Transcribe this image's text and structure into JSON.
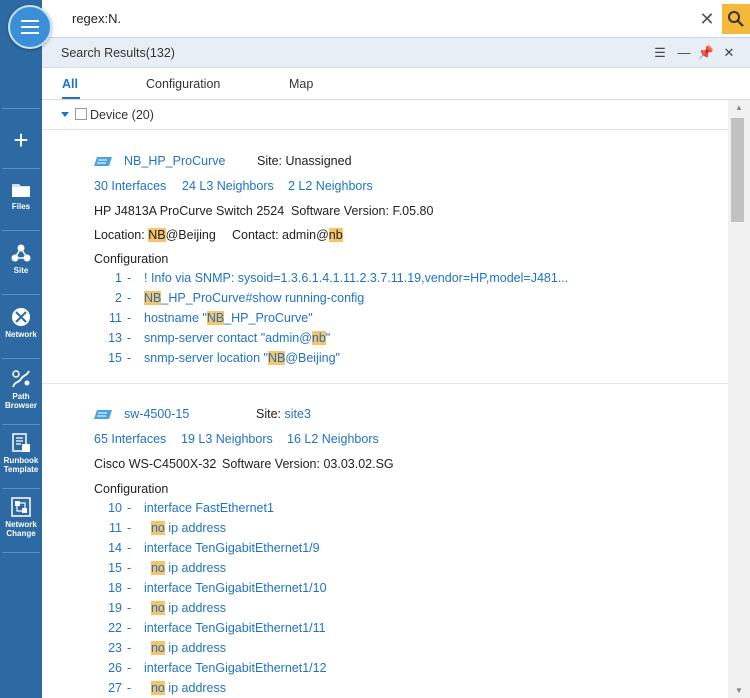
{
  "nav": {
    "items": [
      {
        "label": "Files"
      },
      {
        "label": "Site"
      },
      {
        "label": "Network"
      },
      {
        "label": "Path\nBrowser"
      },
      {
        "label": "Runbook\nTemplate"
      },
      {
        "label": "Network\nChange"
      }
    ]
  },
  "search": {
    "query": "regex:N."
  },
  "panel": {
    "title": "Search Results(132)"
  },
  "tabs": [
    {
      "label": "All",
      "active": true
    },
    {
      "label": "Configuration",
      "active": false
    },
    {
      "label": "Map",
      "active": false
    }
  ],
  "group": {
    "label": "Device (20)"
  },
  "results": [
    {
      "device_name": "NB_HP_ProCurve",
      "site_label": "Site:",
      "site": "Unassigned",
      "interfaces": "30 Interfaces",
      "l3": "24 L3 Neighbors",
      "l2": "2 L2 Neighbors",
      "vendor_model": "HP  J4813A ProCurve Switch 2524",
      "software": "Software Version: F.05.80",
      "location_prefix": "Location: ",
      "location_hl": "NB",
      "location_rest": "@Beijing",
      "contact_prefix": "Contact: admin@",
      "contact_hl": "nb",
      "config_label": "Configuration",
      "config_lines": [
        {
          "num": "1",
          "pre": "! Info via SNMP: sysoid=1.3.6.1.4.1.11.2.3.7.11.19,vendor=HP,model=J481...",
          "hl": "",
          "post": ""
        },
        {
          "num": "2",
          "pre": "",
          "hl": "NB",
          "post": "_HP_ProCurve#show running-config"
        },
        {
          "num": "11",
          "pre": "hostname \"",
          "hl": "NB",
          "post": "_HP_ProCurve\""
        },
        {
          "num": "13",
          "pre": "snmp-server contact \"admin@",
          "hl": "nb",
          "post": "\""
        },
        {
          "num": "15",
          "pre": "snmp-server location \"",
          "hl": "NB",
          "post": "@Beijing\""
        }
      ]
    },
    {
      "device_name": "sw-4500-15",
      "site_label": "Site:",
      "site": "site3",
      "interfaces": "65 Interfaces",
      "l3": "19 L3 Neighbors",
      "l2": "16 L2 Neighbors",
      "vendor_model": "Cisco  WS-C4500X-32",
      "software": "Software Version: 03.03.02.SG",
      "config_label": "Configuration",
      "config_lines": [
        {
          "num": "10",
          "pre": "interface FastEthernet1",
          "hl": "",
          "post": ""
        },
        {
          "num": "11",
          "pre": "  ",
          "hl": "no",
          "post": " ip address"
        },
        {
          "num": "14",
          "pre": "interface TenGigabitEthernet1/9",
          "hl": "",
          "post": ""
        },
        {
          "num": "15",
          "pre": "  ",
          "hl": "no",
          "post": " ip address"
        },
        {
          "num": "18",
          "pre": "interface TenGigabitEthernet1/10",
          "hl": "",
          "post": ""
        },
        {
          "num": "19",
          "pre": "  ",
          "hl": "no",
          "post": " ip address"
        },
        {
          "num": "22",
          "pre": "interface TenGigabitEthernet1/11",
          "hl": "",
          "post": ""
        },
        {
          "num": "23",
          "pre": "  ",
          "hl": "no",
          "post": " ip address"
        },
        {
          "num": "26",
          "pre": "interface TenGigabitEthernet1/12",
          "hl": "",
          "post": ""
        },
        {
          "num": "27",
          "pre": "  ",
          "hl": "no",
          "post": " ip address"
        }
      ]
    }
  ]
}
